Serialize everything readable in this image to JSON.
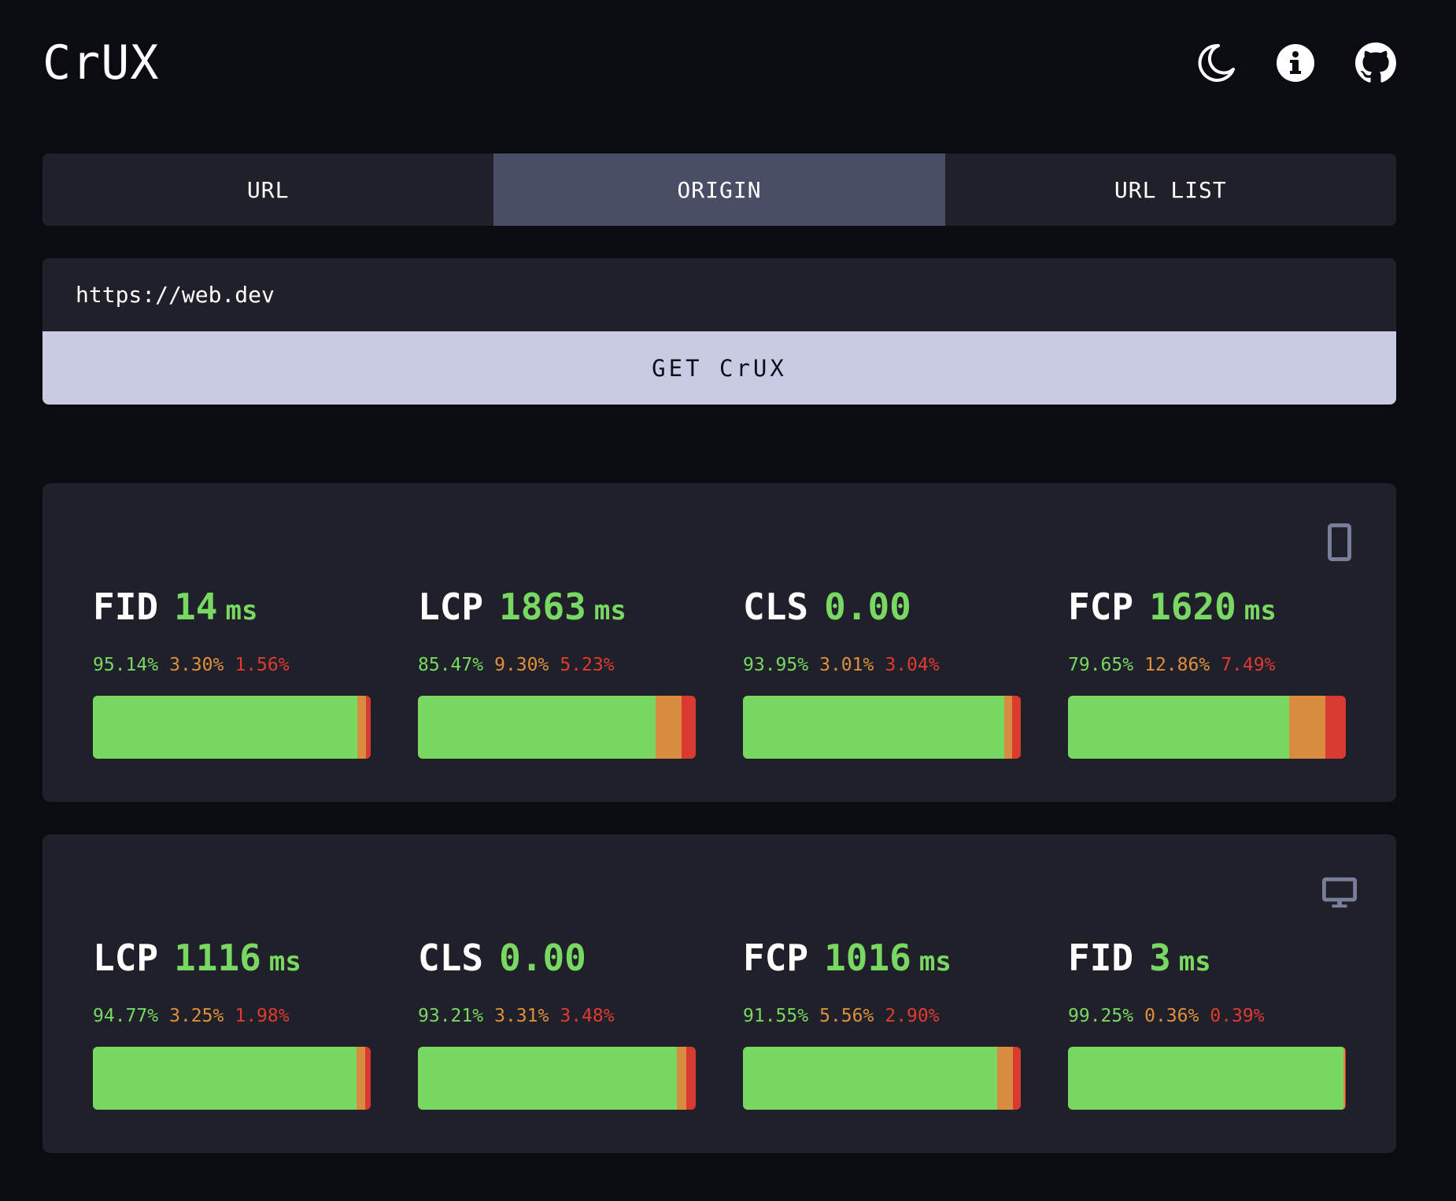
{
  "header": {
    "title": "CrUX",
    "icons": [
      "moon-icon",
      "info-icon",
      "github-icon"
    ]
  },
  "tabs": [
    {
      "label": "URL",
      "active": false
    },
    {
      "label": "ORIGIN",
      "active": true
    },
    {
      "label": "URL LIST",
      "active": false
    }
  ],
  "form": {
    "url_value": "https://web.dev",
    "button_label": "GET CrUX"
  },
  "colors": {
    "good": "#78d862",
    "needs_improvement": "#d78c3f",
    "poor": "#d83a31",
    "accent_button": "#c9cbe4",
    "active_tab": "#4a4d66"
  },
  "panels": [
    {
      "device": "phone-icon",
      "metrics": [
        {
          "name": "FID",
          "value": "14",
          "unit": "ms",
          "good": "95.14%",
          "ni": "3.30%",
          "poor": "1.56%",
          "good_frac": 0.9514,
          "ni_frac": 0.033,
          "poor_frac": 0.0156
        },
        {
          "name": "LCP",
          "value": "1863",
          "unit": "ms",
          "good": "85.47%",
          "ni": "9.30%",
          "poor": "5.23%",
          "good_frac": 0.8547,
          "ni_frac": 0.093,
          "poor_frac": 0.0523
        },
        {
          "name": "CLS",
          "value": "0.00",
          "unit": "",
          "good": "93.95%",
          "ni": "3.01%",
          "poor": "3.04%",
          "good_frac": 0.9395,
          "ni_frac": 0.0301,
          "poor_frac": 0.0304
        },
        {
          "name": "FCP",
          "value": "1620",
          "unit": "ms",
          "good": "79.65%",
          "ni": "12.86%",
          "poor": "7.49%",
          "good_frac": 0.7965,
          "ni_frac": 0.1286,
          "poor_frac": 0.0749
        }
      ]
    },
    {
      "device": "desktop-icon",
      "metrics": [
        {
          "name": "LCP",
          "value": "1116",
          "unit": "ms",
          "good": "94.77%",
          "ni": "3.25%",
          "poor": "1.98%",
          "good_frac": 0.9477,
          "ni_frac": 0.0325,
          "poor_frac": 0.0198
        },
        {
          "name": "CLS",
          "value": "0.00",
          "unit": "",
          "good": "93.21%",
          "ni": "3.31%",
          "poor": "3.48%",
          "good_frac": 0.9321,
          "ni_frac": 0.0331,
          "poor_frac": 0.0348
        },
        {
          "name": "FCP",
          "value": "1016",
          "unit": "ms",
          "good": "91.55%",
          "ni": "5.56%",
          "poor": "2.90%",
          "good_frac": 0.9155,
          "ni_frac": 0.0556,
          "poor_frac": 0.029
        },
        {
          "name": "FID",
          "value": "3",
          "unit": "ms",
          "good": "99.25%",
          "ni": "0.36%",
          "poor": "0.39%",
          "good_frac": 0.9925,
          "ni_frac": 0.0036,
          "poor_frac": 0.0039
        }
      ]
    }
  ]
}
